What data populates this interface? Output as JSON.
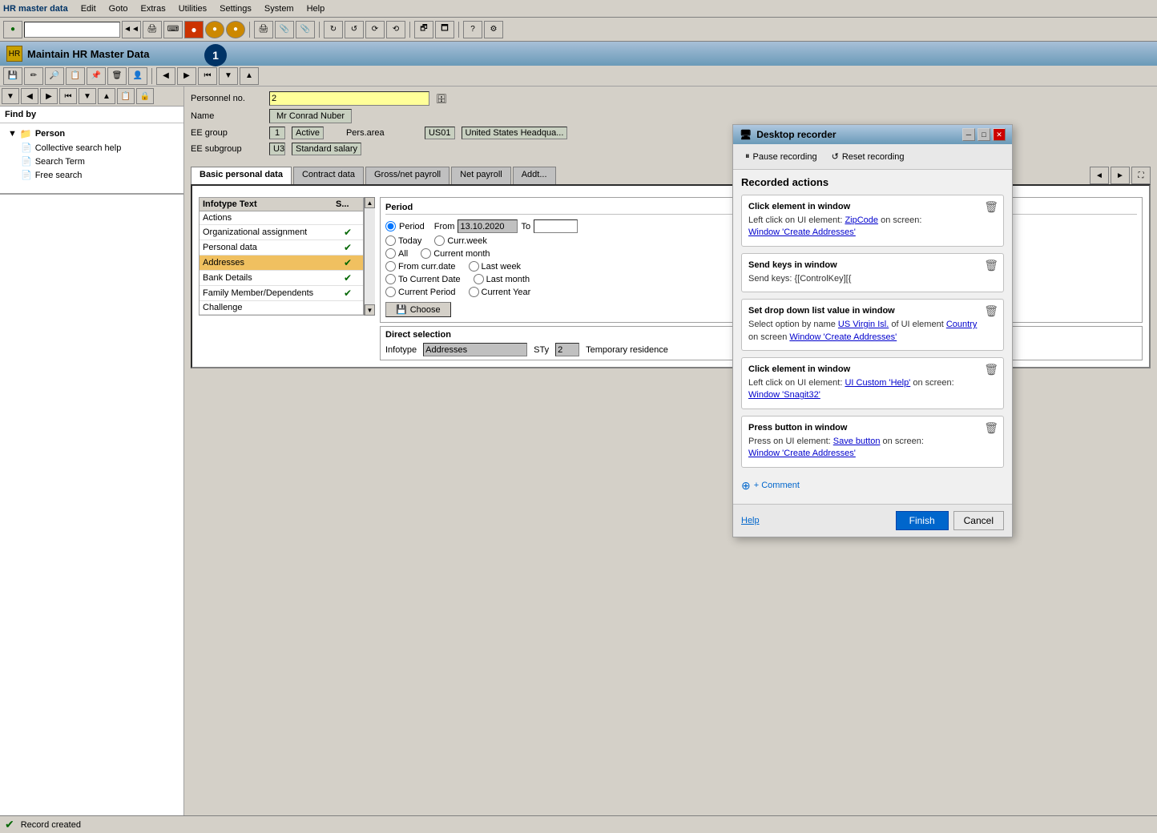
{
  "app": {
    "title": "Maintain HR Master Data",
    "menu_items": [
      "HR master data",
      "Edit",
      "Goto",
      "Extras",
      "Utilities",
      "Settings",
      "System",
      "Help"
    ]
  },
  "toolbar": {
    "input_value": "",
    "badge_number": "1"
  },
  "form": {
    "personnel_label": "Personnel no.",
    "personnel_value": "2",
    "name_label": "Name",
    "name_value": "Mr Conrad Nuber",
    "ee_group_label": "EE group",
    "ee_group_value": "1",
    "ee_group_status": "Active",
    "pers_area_label": "Pers.area",
    "pers_area_code": "US01",
    "pers_area_name": "United States Headqua...",
    "ee_subgroup_label": "EE subgroup",
    "ee_subgroup_value": "U3",
    "ee_subgroup_name": "Standard salary"
  },
  "tabs": [
    "Basic personal data",
    "Contract data",
    "Gross/net payroll",
    "Net payroll",
    "Addt..."
  ],
  "active_tab": "Basic personal data",
  "infotype_table": {
    "col1_header": "Infotype Text",
    "col2_header": "S...",
    "rows": [
      {
        "text": "Actions",
        "checked": false,
        "selected": false
      },
      {
        "text": "Organizational assignment",
        "checked": true,
        "selected": false
      },
      {
        "text": "Personal data",
        "checked": true,
        "selected": false
      },
      {
        "text": "Addresses",
        "checked": true,
        "selected": true
      },
      {
        "text": "Bank Details",
        "checked": true,
        "selected": false
      },
      {
        "text": "Family Member/Dependents",
        "checked": true,
        "selected": false
      },
      {
        "text": "Challenge",
        "checked": false,
        "selected": false
      }
    ]
  },
  "period": {
    "title": "Period",
    "period_label": "Period",
    "from_label": "From",
    "from_value": "13.10.2020",
    "to_label": "To",
    "to_value": "",
    "radio_options": [
      "Today",
      "Curr.week",
      "All",
      "Current month",
      "From curr.date",
      "Last week",
      "To Current Date",
      "Last month",
      "Current Period",
      "Current Year"
    ],
    "choose_label": "Choose"
  },
  "direct_selection": {
    "title": "Direct selection",
    "infotype_label": "Infotype",
    "infotype_value": "Addresses",
    "sty_label": "STy",
    "sty_value": "2",
    "sty_name": "Temporary residence"
  },
  "left_panel": {
    "find_by_label": "Find by",
    "tree": {
      "parent": "Person",
      "children": [
        "Collective search help",
        "Search Term",
        "Free search"
      ]
    }
  },
  "recorder": {
    "title": "Desktop recorder",
    "pause_btn": "Pause recording",
    "reset_btn": "Reset recording",
    "actions_title": "Recorded actions",
    "actions": [
      {
        "title": "Click element in window",
        "desc_prefix": "Left click on UI element: ",
        "element": "ZipCode",
        "desc_middle": " on screen:",
        "screen": "Window 'Create Addresses'"
      },
      {
        "title": "Send keys in window",
        "desc_prefix": "Send keys: ",
        "keys": "{[ControlKey][(",
        "desc_middle": "",
        "screen": ""
      },
      {
        "title": "Set drop down list value in window",
        "desc_prefix": "Select option by name ",
        "element": "US Virgin Isl.",
        "desc_middle": " of UI element ",
        "element2": "Country",
        "desc_suffix": " on screen ",
        "screen": "Window 'Create Addresses'"
      },
      {
        "title": "Click element in window",
        "desc_prefix": "Left click on UI element: ",
        "element": "UI Custom 'Help'",
        "desc_middle": " on screen:",
        "screen": "Window 'Snagit32'"
      },
      {
        "title": "Press button in window",
        "desc_prefix": "Press on UI element: ",
        "element": "Save button",
        "desc_middle": " on screen:",
        "screen": "Window 'Create Addresses'"
      }
    ],
    "comment_label": "+ Comment",
    "help_label": "Help",
    "finish_label": "Finish",
    "cancel_label": "Cancel"
  },
  "status_bar": {
    "message": "Record created"
  }
}
